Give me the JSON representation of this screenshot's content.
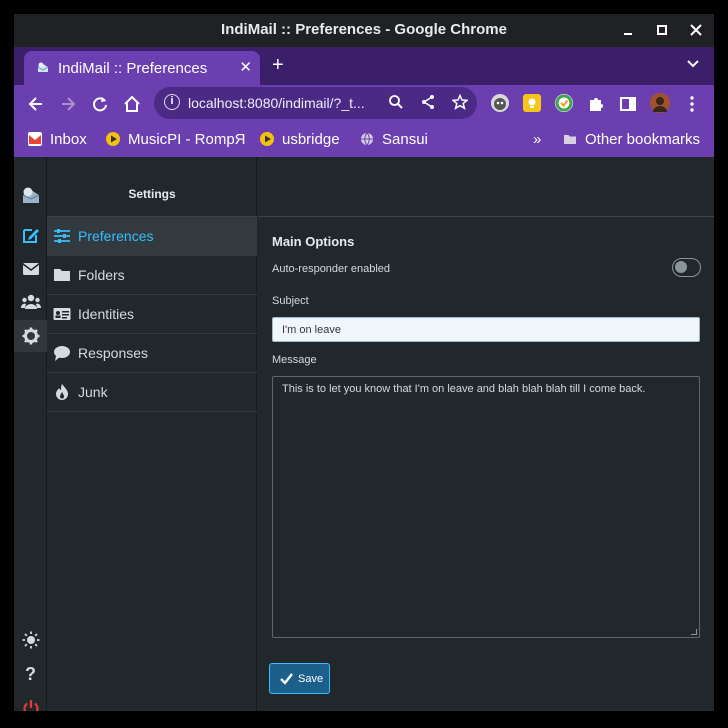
{
  "window": {
    "title": "IndiMail :: Preferences - Google Chrome"
  },
  "tab": {
    "title": "IndiMail :: Preferences"
  },
  "omnibox": {
    "url": "localhost:8080/indimail/?_t..."
  },
  "bookmarks": [
    {
      "label": "Inbox",
      "icon": "gmail-icon"
    },
    {
      "label": "MusicPI - RompЯ",
      "icon": "play-icon"
    },
    {
      "label": "usbridge",
      "icon": "play-icon"
    },
    {
      "label": "Sansui",
      "icon": "globe-icon"
    }
  ],
  "bookmarks_overflow": "»",
  "other_bookmarks": "Other bookmarks",
  "settings": {
    "header": "Settings",
    "items": [
      {
        "label": "Preferences",
        "icon": "sliders-icon",
        "active": true
      },
      {
        "label": "Folders",
        "icon": "folder-icon"
      },
      {
        "label": "Identities",
        "icon": "id-card-icon"
      },
      {
        "label": "Responses",
        "icon": "comment-icon"
      },
      {
        "label": "Junk",
        "icon": "fire-icon"
      }
    ]
  },
  "main_options": {
    "title": "Main Options",
    "autoresponder_label": "Auto-responder enabled",
    "autoresponder_enabled": false,
    "subject_label": "Subject",
    "subject_value": "I'm on leave",
    "message_label": "Message",
    "message_value": "This is to let you know that I'm on leave and blah blah blah till I come back.",
    "save_label": "Save"
  },
  "colors": {
    "accent": "#37beff",
    "chrome_purple": "#6b3fb0",
    "app_bg": "#22272b",
    "logout_red": "#e03c3c"
  }
}
